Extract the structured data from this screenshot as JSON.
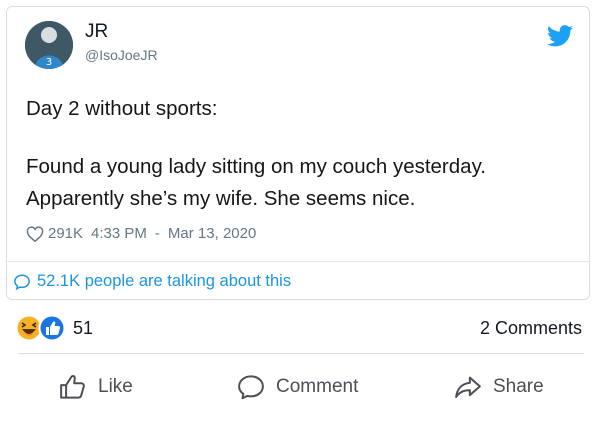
{
  "tweet": {
    "display_name": "JR",
    "handle": "@IsoJoeJR",
    "lines": [
      "Day 2 without sports:",
      "Found a young lady sitting on my couch yesterday.",
      "Apparently she’s my wife. She seems nice."
    ],
    "likes": "291K",
    "time": "4:33 PM",
    "separator": "-",
    "date": "Mar 13, 2020",
    "talking": "52.1K people are talking about this",
    "avatar_jersey_number": "3",
    "brand_color": "#1da1f2",
    "link_color": "#1b95e0"
  },
  "facebook": {
    "reaction_count": "51",
    "comments": "2 Comments",
    "actions": {
      "like": "Like",
      "comment": "Comment",
      "share": "Share"
    },
    "icons": [
      "haha-reaction-icon",
      "like-reaction-icon"
    ]
  }
}
